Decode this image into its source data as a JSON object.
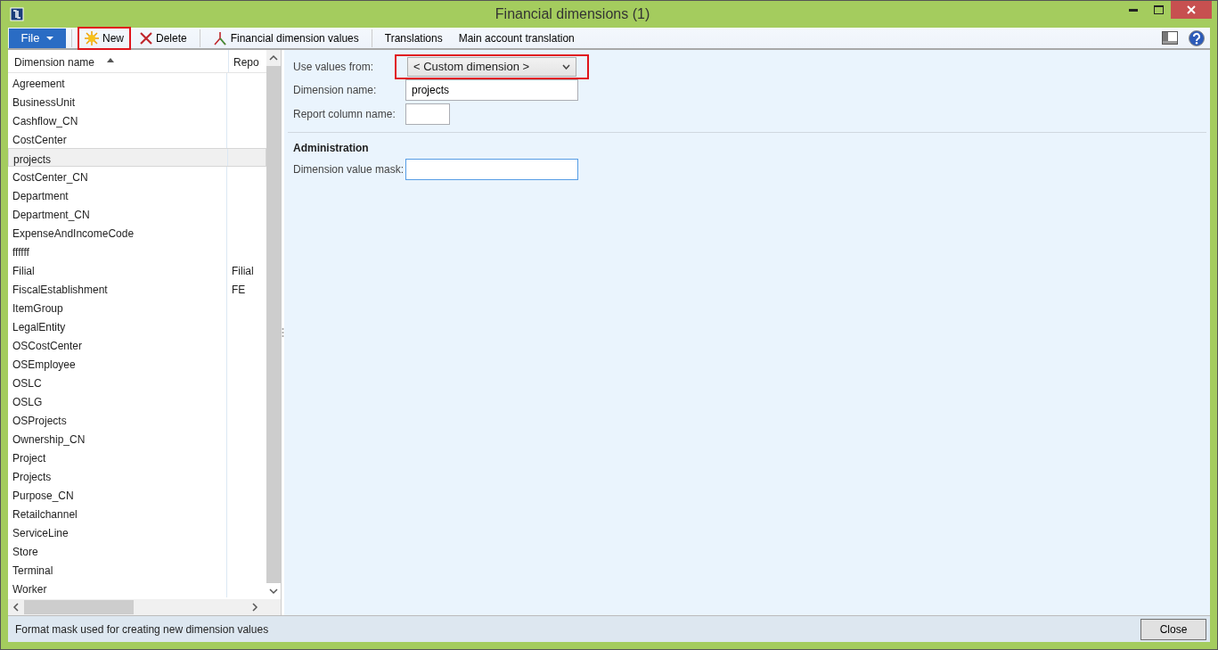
{
  "window": {
    "title": "Financial dimensions (1)"
  },
  "toolbar": {
    "file_menu": "File",
    "buttons": [
      {
        "kind": "new",
        "label": "New",
        "highlighted": true
      },
      {
        "kind": "delete",
        "label": "Delete",
        "highlighted": false
      },
      {
        "kind": "values",
        "label": "Financial dimension values",
        "highlighted": false
      },
      {
        "kind": "plain",
        "label": "Translations",
        "highlighted": false
      },
      {
        "kind": "plain",
        "label": "Main account translation",
        "highlighted": false
      }
    ]
  },
  "list": {
    "columns": [
      "Dimension name",
      "Repo"
    ],
    "rows": [
      {
        "name": "Agreement",
        "column_2": "",
        "selected": false
      },
      {
        "name": "BusinessUnit",
        "column_2": "",
        "selected": false
      },
      {
        "name": "Cashflow_CN",
        "column_2": "",
        "selected": false
      },
      {
        "name": "CostCenter",
        "column_2": "",
        "selected": false
      },
      {
        "name": "projects",
        "column_2": "",
        "selected": true
      },
      {
        "name": "CostCenter_CN",
        "column_2": "",
        "selected": false
      },
      {
        "name": "Department",
        "column_2": "",
        "selected": false
      },
      {
        "name": "Department_CN",
        "column_2": "",
        "selected": false
      },
      {
        "name": "ExpenseAndIncomeCode",
        "column_2": "",
        "selected": false
      },
      {
        "name": "ffffff",
        "column_2": "",
        "selected": false
      },
      {
        "name": "Filial",
        "column_2": "Filial",
        "selected": false
      },
      {
        "name": "FiscalEstablishment",
        "column_2": "FE",
        "selected": false
      },
      {
        "name": "ItemGroup",
        "column_2": "",
        "selected": false
      },
      {
        "name": "LegalEntity",
        "column_2": "",
        "selected": false
      },
      {
        "name": "OSCostCenter",
        "column_2": "",
        "selected": false
      },
      {
        "name": "OSEmployee",
        "column_2": "",
        "selected": false
      },
      {
        "name": "OSLC",
        "column_2": "",
        "selected": false
      },
      {
        "name": "OSLG",
        "column_2": "",
        "selected": false
      },
      {
        "name": "OSProjects",
        "column_2": "",
        "selected": false
      },
      {
        "name": "Ownership_CN",
        "column_2": "",
        "selected": false
      },
      {
        "name": "Project",
        "column_2": "",
        "selected": false
      },
      {
        "name": "Projects",
        "column_2": "",
        "selected": false
      },
      {
        "name": "Purpose_CN",
        "column_2": "",
        "selected": false
      },
      {
        "name": "Retailchannel",
        "column_2": "",
        "selected": false
      },
      {
        "name": "ServiceLine",
        "column_2": "",
        "selected": false
      },
      {
        "name": "Store",
        "column_2": "",
        "selected": false
      },
      {
        "name": "Terminal",
        "column_2": "",
        "selected": false
      },
      {
        "name": "Worker",
        "column_2": "",
        "selected": false
      }
    ]
  },
  "form": {
    "fields": [
      {
        "kind": "dropdown",
        "label": "Use values from:",
        "value": "< Custom dimension >",
        "highlighted": true
      },
      {
        "kind": "text",
        "label": "Dimension name:",
        "value": "projects"
      },
      {
        "kind": "short",
        "label": "Report column name:"
      }
    ],
    "section": "Administration",
    "section_fields": [
      {
        "kind": "text",
        "label": "Dimension value mask:",
        "focused": true
      }
    ]
  },
  "status_bar": {
    "text": "Format mask used for creating new dimension values",
    "button": "Close"
  }
}
